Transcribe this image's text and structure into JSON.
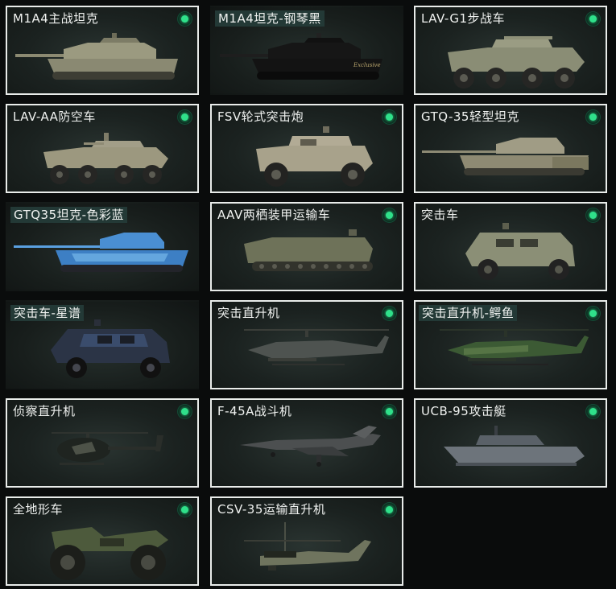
{
  "vehicles": [
    {
      "name": "M1A4主战坦克",
      "icon": "tank-icon",
      "owned": true
    },
    {
      "name": "M1A4坦克-钢琴黑",
      "icon": "tank-icon",
      "owned": false
    },
    {
      "name": "LAV-G1步战车",
      "icon": "ifv-icon",
      "owned": true
    },
    {
      "name": "LAV-AA防空车",
      "icon": "aa-vehicle-icon",
      "owned": true
    },
    {
      "name": "FSV轮式突击炮",
      "icon": "armored-car-icon",
      "owned": true
    },
    {
      "name": "GTQ-35轻型坦克",
      "icon": "light-tank-icon",
      "owned": true
    },
    {
      "name": "GTQ35坦克-色彩蓝",
      "icon": "light-tank-icon",
      "owned": false
    },
    {
      "name": "AAV两栖装甲运输车",
      "icon": "amphibious-apc-icon",
      "owned": true
    },
    {
      "name": "突击车",
      "icon": "assault-vehicle-icon",
      "owned": true
    },
    {
      "name": "突击车-星谱",
      "icon": "assault-vehicle-icon",
      "owned": false
    },
    {
      "name": "突击直升机",
      "icon": "attack-helicopter-icon",
      "owned": true
    },
    {
      "name": "突击直升机-鳄鱼",
      "icon": "attack-helicopter-icon",
      "owned": false
    },
    {
      "name": "侦察直升机",
      "icon": "scout-helicopter-icon",
      "owned": true
    },
    {
      "name": "F-45A战斗机",
      "icon": "fighter-jet-icon",
      "owned": true
    },
    {
      "name": "UCB-95攻击艇",
      "icon": "attack-boat-icon",
      "owned": true
    },
    {
      "name": "全地形车",
      "icon": "atv-icon",
      "owned": true
    },
    {
      "name": "CSV-35运输直升机",
      "icon": "transport-helicopter-icon",
      "owned": true
    }
  ],
  "colors": {
    "owned_indicator": "#2fe08a",
    "card_border": "#e9ecea",
    "background": "#0a0c0c",
    "skin_label_bg": "#233936"
  }
}
